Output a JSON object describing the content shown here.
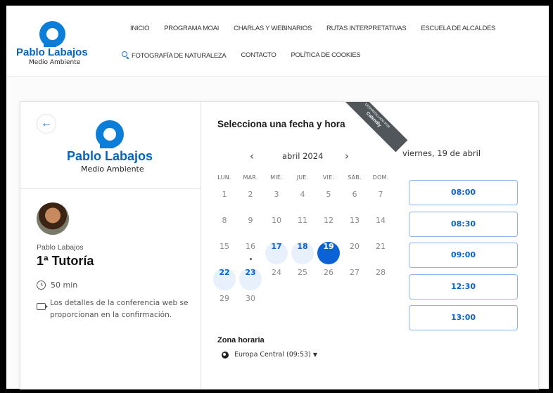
{
  "header": {
    "logo": {
      "name": "Pablo Labajos",
      "subtitle": "Medio Ambiente"
    },
    "nav_row1": [
      "INICIO",
      "PROGRAMA MOAI",
      "CHARLAS Y WEBINARIOS",
      "RUTAS INTERPRETATIVAS",
      "ESCUELA DE ALCALDES"
    ],
    "nav_row2": [
      "FOTOGRAFÍA DE NATURALEZA",
      "CONTACTO",
      "POLÍTICA DE COOKIES"
    ]
  },
  "event": {
    "back_icon": "arrow-left-icon",
    "logo_name": "Pablo Labajos",
    "logo_subtitle": "Medio Ambiente",
    "host": "Pablo Labajos",
    "title": "1ª Tutoría",
    "duration": "50 min",
    "conference_note": "Los detalles de la conferencia web se proporcionan en la confirmación."
  },
  "calendar": {
    "heading": "Selecciona una fecha y hora",
    "prev_label": "‹",
    "next_label": "›",
    "month": "abril 2024",
    "selected_date_label": "viernes, 19 de abril",
    "weekdays": [
      "LUN.",
      "MAR.",
      "MIÉ.",
      "JUE.",
      "VIE.",
      "SÁB.",
      "DOM."
    ],
    "days": [
      "1",
      "2",
      "3",
      "4",
      "5",
      "6",
      "7",
      "8",
      "9",
      "10",
      "11",
      "12",
      "13",
      "14",
      "15",
      "16",
      "17",
      "18",
      "19",
      "20",
      "21",
      "22",
      "23",
      "24",
      "25",
      "26",
      "27",
      "28",
      "29",
      "30"
    ],
    "available_days": [
      "17",
      "18",
      "22",
      "23"
    ],
    "selected_day": "19",
    "today_marker_day": "16",
    "accent_color": "#0b62d6"
  },
  "timezone": {
    "label": "Zona horaria",
    "value": "Europa Central (09:53)"
  },
  "time_slots": [
    "08:00",
    "08:30",
    "09:00",
    "12:30",
    "13:00"
  ],
  "ribbon": {
    "line1": "DESARROLLADO POR",
    "line2": "Calendly"
  }
}
